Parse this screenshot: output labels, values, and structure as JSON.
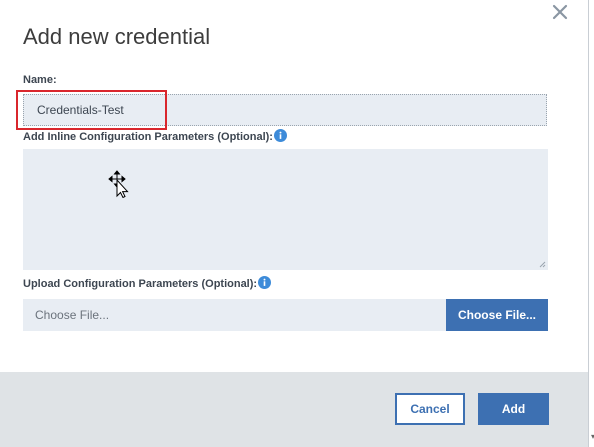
{
  "dialog": {
    "title": "Add new credential",
    "close_icon": "close-icon"
  },
  "name_field": {
    "label": "Name:",
    "value": "Credentials-Test"
  },
  "inline_params": {
    "label": "Add Inline Configuration Parameters (Optional):",
    "info_icon": "info-icon",
    "value": ""
  },
  "upload_params": {
    "label": "Upload Configuration Parameters (Optional):",
    "info_icon": "info-icon",
    "file_placeholder": "Choose File...",
    "choose_button_label": "Choose File..."
  },
  "footer": {
    "cancel_label": "Cancel",
    "add_label": "Add"
  },
  "colors": {
    "accent": "#3d70b2",
    "field_background": "#e8edf3",
    "footer_background": "#dfe3e6",
    "highlight": "#d9262c"
  }
}
